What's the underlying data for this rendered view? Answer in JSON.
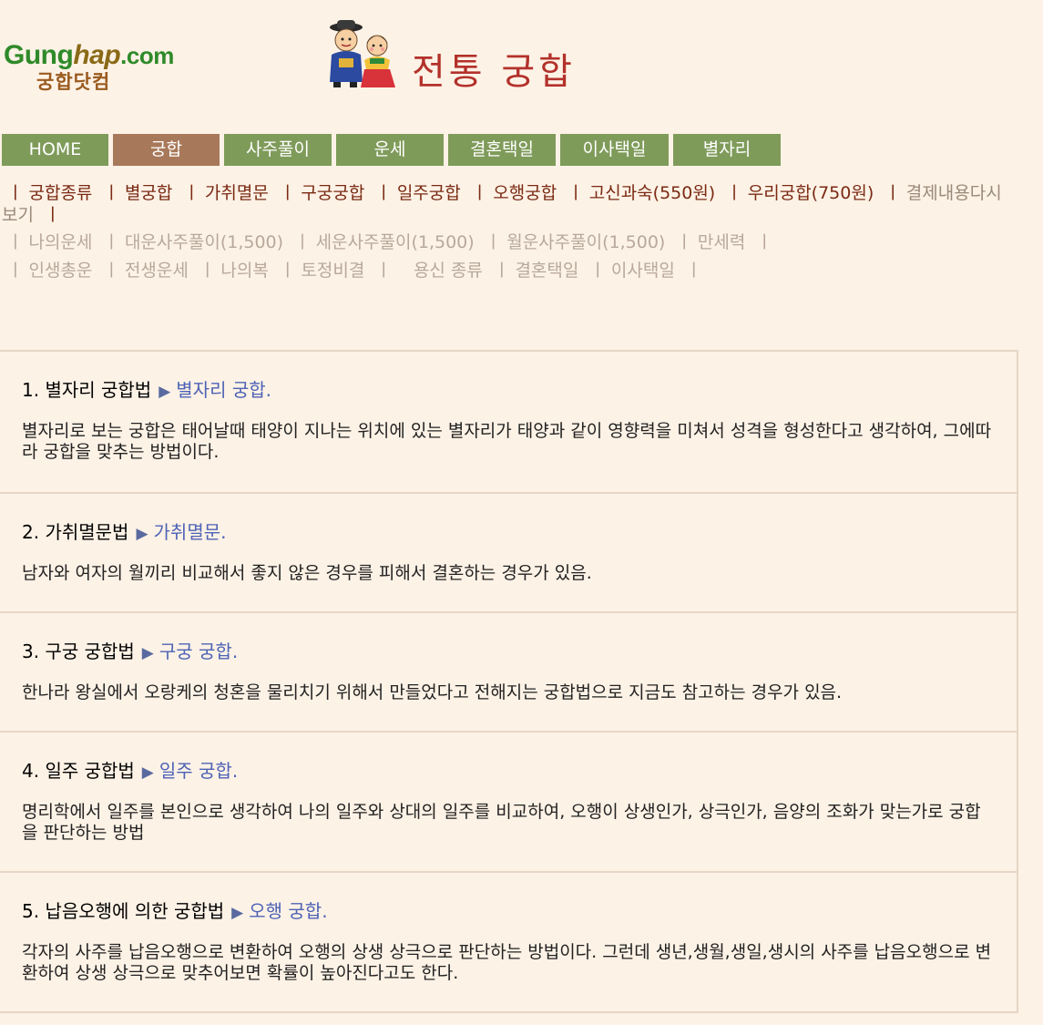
{
  "header": {
    "logo_text_part1": "Gung",
    "logo_text_part2": "hap",
    "logo_text_part3": ".com",
    "logo_korean": "궁합닷컴",
    "title": "전통 궁합"
  },
  "nav": {
    "tabs": [
      {
        "label": "HOME",
        "active": false
      },
      {
        "label": "궁합",
        "active": true
      },
      {
        "label": "사주풀이",
        "active": false
      },
      {
        "label": "운세",
        "active": false
      },
      {
        "label": "결혼택일",
        "active": false
      },
      {
        "label": "이사택일",
        "active": false
      },
      {
        "label": "별자리",
        "active": false
      }
    ]
  },
  "links": {
    "row1": [
      "궁합종류",
      "별궁합",
      "가취멸문",
      "구궁궁합",
      "일주궁합",
      "오행궁합",
      "고신과숙(550원)",
      "우리궁합(750원)"
    ],
    "row1_dim": "결제내용다시보기",
    "row2": [
      "나의운세",
      "대운사주풀이(1,500)",
      "세운사주풀이(1,500)",
      "월운사주풀이(1,500)",
      "만세력"
    ],
    "row3": [
      "인생총운",
      "전생운세",
      "나의복",
      "토정비결",
      "용신 종류",
      "결혼택일",
      "이사택일"
    ]
  },
  "sections": [
    {
      "heading": "1. 별자리 궁합법",
      "link": "별자리 궁합.",
      "desc": "별자리로 보는 궁합은 태어날때 태양이 지나는 위치에 있는 별자리가 태양과 같이 영향력을 미쳐서 성격을 형성한다고 생각하여, 그에따라 궁합을 맞추는 방법이다."
    },
    {
      "heading": "2. 가취멸문법",
      "link": "가취멸문.",
      "desc": "남자와 여자의 월끼리 비교해서 좋지 않은 경우를 피해서 결혼하는 경우가 있음."
    },
    {
      "heading": "3. 구궁 궁합법",
      "link": "구궁 궁합.",
      "desc": "한나라 왕실에서 오랑케의 청혼을 물리치기 위해서 만들었다고 전해지는 궁합법으로 지금도 참고하는 경우가 있음."
    },
    {
      "heading": "4. 일주 궁합법",
      "link": "일주 궁합.",
      "desc": "명리학에서 일주를 본인으로 생각하여 나의 일주와 상대의 일주를 비교하여, 오행이 상생인가, 상극인가, 음양의 조화가 맞는가로 궁합을 판단하는 방법"
    },
    {
      "heading": "5. 납음오행에 의한 궁합법",
      "link": "오행 궁합.",
      "desc": "각자의 사주를 납음오행으로 변환하여 오행의 상생 상극으로 판단하는 방법이다. 그런데 생년,생월,생일,생시의 사주를 납음오행으로 변환하여 상생 상극으로 맞추어보면 확률이 높아진다고도 한다."
    }
  ],
  "arrow_glyph": "▶",
  "separator": "ㅣ",
  "colors": {
    "background": "#fdf2e6",
    "nav_tab": "#7f9b5a",
    "nav_tab_active": "#a7795a",
    "title_red": "#b3312b",
    "link_blue": "#4d63b5"
  }
}
